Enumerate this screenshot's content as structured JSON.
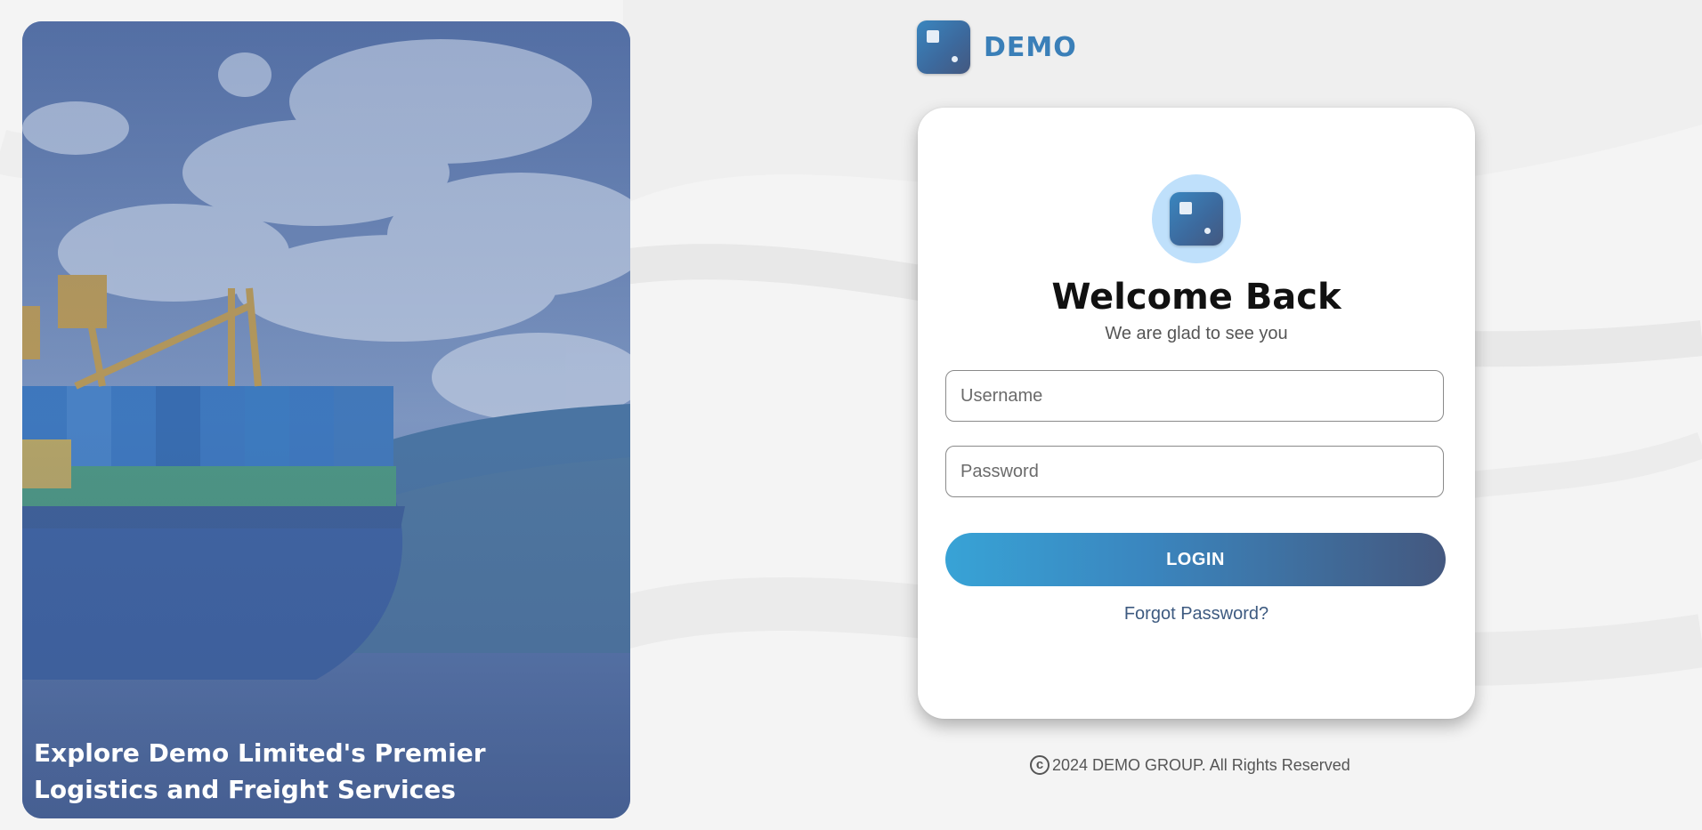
{
  "hero": {
    "caption": "Explore Demo Limited's Premier Logistics and Freight Services"
  },
  "brand": {
    "name": "DEMO",
    "logo_icon": "square-dot-logo-icon",
    "accent_color": "#3a7fb8"
  },
  "login": {
    "title": "Welcome Back",
    "subtitle": "We are glad to see you",
    "username_placeholder": "Username",
    "username_value": "",
    "password_placeholder": "Password",
    "password_value": "",
    "login_label": "LOGIN",
    "forgot_label": "Forgot Password?"
  },
  "footer": {
    "copyright_symbol": "c",
    "text": "2024 DEMO GROUP. All Rights Reserved"
  },
  "colors": {
    "button_gradient_start": "#38a3d6",
    "button_gradient_end": "#44587f",
    "avatar_bg": "#bfe0fb",
    "link": "#3d5a80"
  }
}
